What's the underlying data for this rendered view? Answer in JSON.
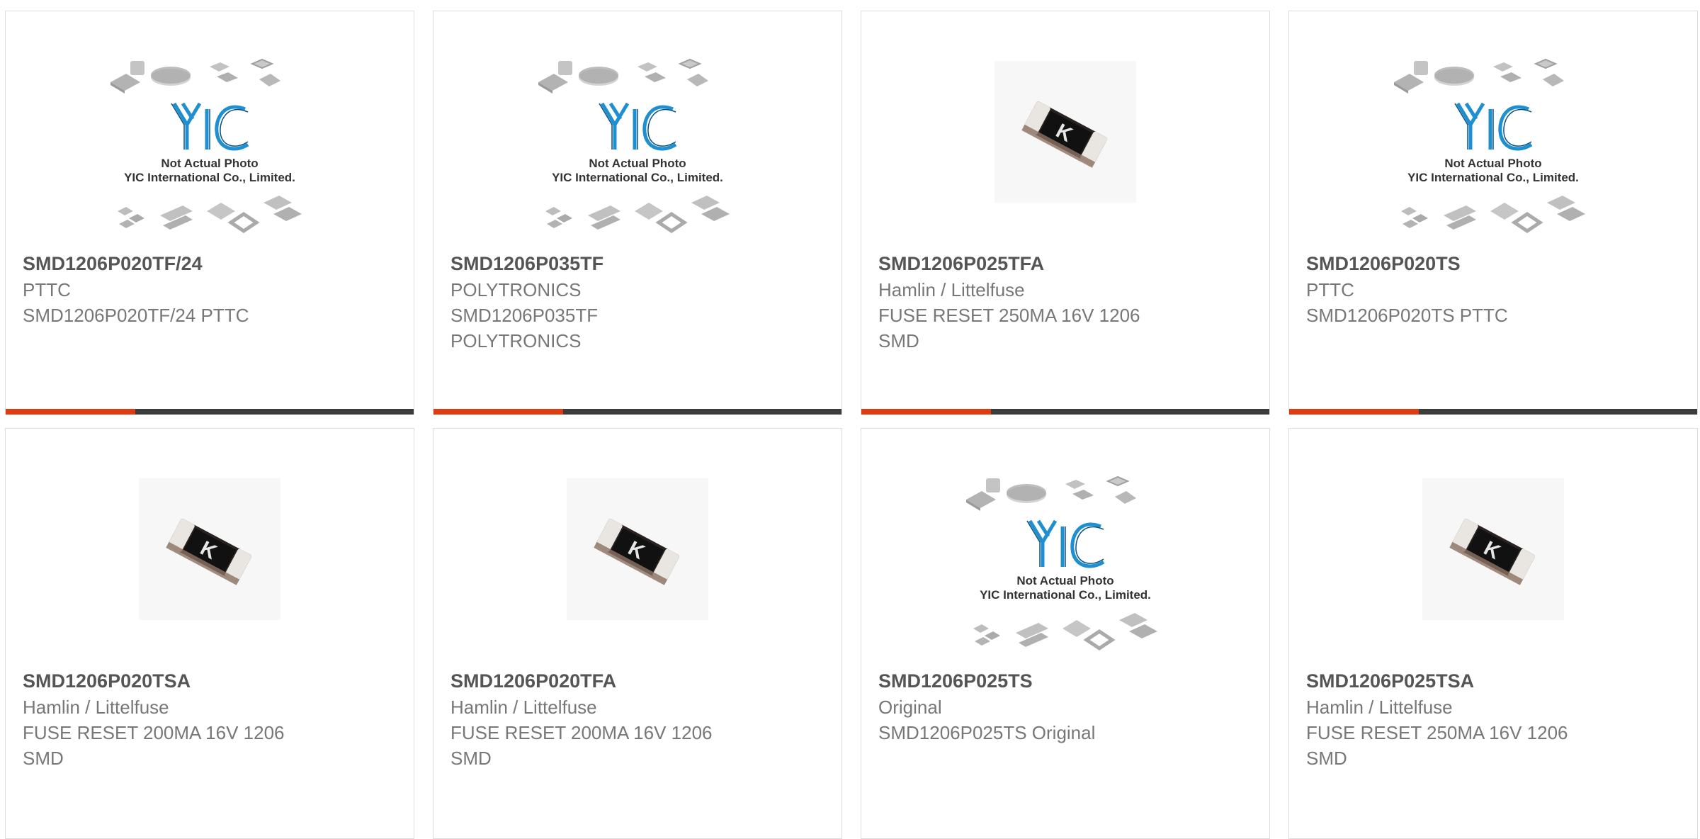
{
  "colors": {
    "accent": "#e03a10",
    "bar": "#3c3c3c",
    "title": "#555555",
    "text": "#777777",
    "yic_blue": "#1e8fd0"
  },
  "placeholder_image": {
    "caption_line1": "Not Actual Photo",
    "caption_line2": "YIC International Co., Limited."
  },
  "products": [
    {
      "part": "SMD1206P020TF/24",
      "maker": "PTTC",
      "desc": "SMD1206P020TF/24 PTTC",
      "image": "placeholder"
    },
    {
      "part": "SMD1206P035TF",
      "maker": "POLYTRONICS",
      "desc": "SMD1206P035TF POLYTRONICS",
      "image": "placeholder"
    },
    {
      "part": "SMD1206P025TFA",
      "maker": "Hamlin / Littelfuse",
      "desc": "FUSE RESET 250MA 16V 1206 SMD",
      "image": "chip-fuse-photo"
    },
    {
      "part": "SMD1206P020TS",
      "maker": "PTTC",
      "desc": "SMD1206P020TS PTTC",
      "image": "placeholder"
    },
    {
      "part": "SMD1206P020TSA",
      "maker": "Hamlin / Littelfuse",
      "desc": "FUSE RESET 200MA 16V 1206 SMD",
      "image": "chip-fuse-photo"
    },
    {
      "part": "SMD1206P020TFA",
      "maker": "Hamlin / Littelfuse",
      "desc": "FUSE RESET 200MA 16V 1206 SMD",
      "image": "chip-fuse-photo"
    },
    {
      "part": "SMD1206P025TS",
      "maker": "Original",
      "desc": "SMD1206P025TS Original",
      "image": "placeholder"
    },
    {
      "part": "SMD1206P025TSA",
      "maker": "Hamlin / Littelfuse",
      "desc": "FUSE RESET 250MA 16V 1206 SMD",
      "image": "chip-fuse-photo"
    }
  ]
}
